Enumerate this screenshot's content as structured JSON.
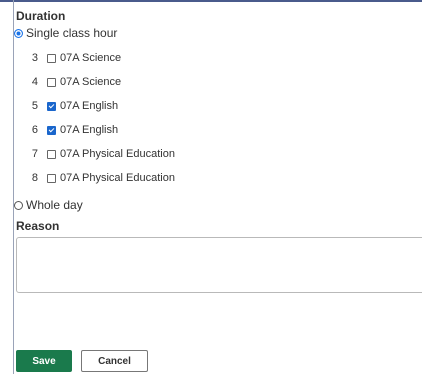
{
  "duration": {
    "label": "Duration",
    "options": {
      "single": {
        "label": "Single class hour",
        "checked": true
      },
      "whole_day": {
        "label": "Whole day",
        "checked": false
      }
    },
    "periods": [
      {
        "number": "3",
        "label": "07A Science",
        "checked": false
      },
      {
        "number": "4",
        "label": "07A Science",
        "checked": false
      },
      {
        "number": "5",
        "label": "07A English",
        "checked": true
      },
      {
        "number": "6",
        "label": "07A English",
        "checked": true
      },
      {
        "number": "7",
        "label": "07A Physical Education",
        "checked": false
      },
      {
        "number": "8",
        "label": "07A Physical Education",
        "checked": false
      }
    ]
  },
  "reason": {
    "label": "Reason",
    "value": ""
  },
  "actions": {
    "save_label": "Save",
    "cancel_label": "Cancel"
  },
  "colors": {
    "save_button": "#1a7a4c",
    "checkbox_checked": "#1a66cc",
    "radio_checked": "#1a73e8"
  }
}
